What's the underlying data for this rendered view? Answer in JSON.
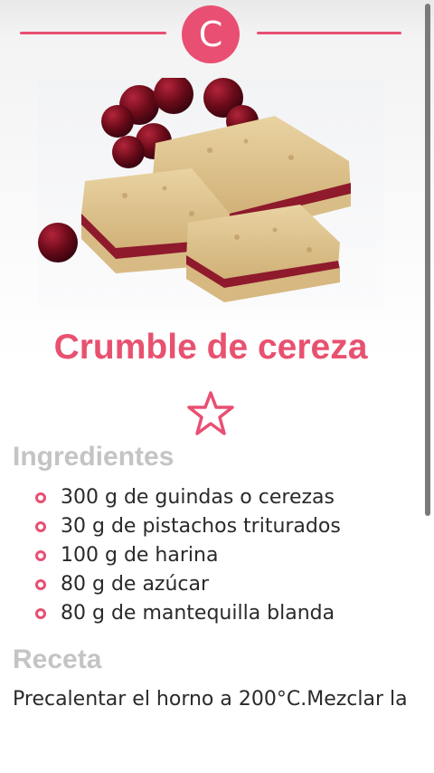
{
  "header": {
    "letter": "C"
  },
  "recipe": {
    "image_alt": "Crumble de cereza photo",
    "title": "Crumble de cereza",
    "favorite_icon": "star-outline-icon"
  },
  "ingredients": {
    "heading": "Ingredientes",
    "items": [
      "300 g de guindas o cerezas",
      "30 g de pistachos triturados",
      "100 g de harina",
      "80 g de azúcar",
      "80 g de mantequilla blanda"
    ]
  },
  "instructions": {
    "heading": "Receta",
    "text": "Precalentar el horno a 200°C.Mezclar la"
  },
  "colors": {
    "accent": "#e94f72",
    "heading_gray": "#c4c4c4",
    "body_text": "#2a2a2a"
  }
}
